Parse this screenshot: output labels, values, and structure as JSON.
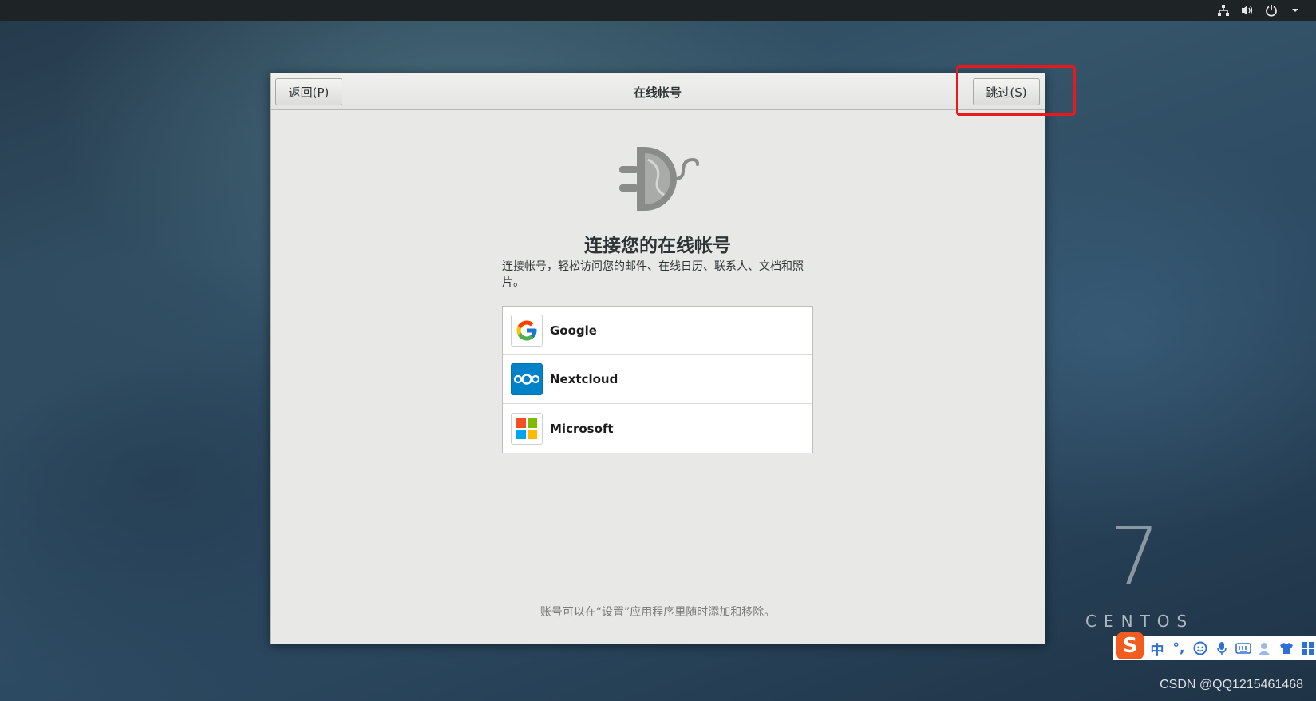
{
  "topbar": {
    "icons": [
      "network-icon",
      "volume-icon",
      "power-icon",
      "chevron-down-icon"
    ]
  },
  "dialog": {
    "title": "在线帐号",
    "back_label": "返回(P)",
    "skip_label": "跳过(S)",
    "heading": "连接您的在线帐号",
    "description": "连接帐号，轻松访问您的邮件、在线日历、联系人、文档和照片。",
    "providers": [
      {
        "name": "Google",
        "icon": "google-logo-icon"
      },
      {
        "name": "Nextcloud",
        "icon": "nextcloud-logo-icon"
      },
      {
        "name": "Microsoft",
        "icon": "microsoft-logo-icon"
      }
    ],
    "footnote": "账号可以在“设置”应用程序里随时添加和移除。"
  },
  "desktop": {
    "centos_version": "7",
    "centos_word": "CENTOS"
  },
  "ime": {
    "mode_label": "中",
    "punct_label": "°,",
    "icons": [
      "sogou-logo-icon",
      "emoji-icon",
      "microphone-icon",
      "keyboard-icon",
      "user-icon",
      "skin-icon",
      "grid-icon"
    ]
  },
  "watermark": "CSDN @QQ1215461468",
  "colors": {
    "highlight": "#e8191c",
    "nextcloud_blue": "#0082c9",
    "sogou_orange": "#f25c1f"
  }
}
